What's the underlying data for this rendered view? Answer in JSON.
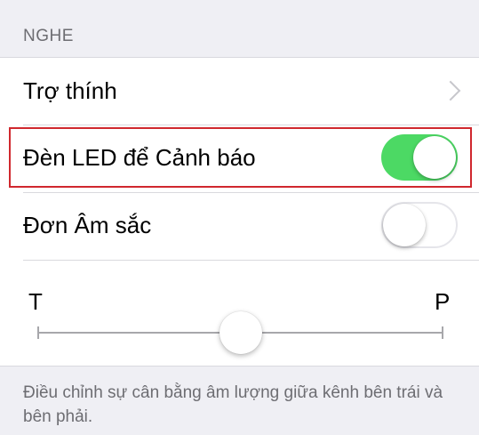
{
  "section": {
    "header": "NGHE"
  },
  "rows": {
    "hearing_aids": {
      "label": "Trợ thính"
    },
    "led_flash": {
      "label": "Đèn LED để Cảnh báo",
      "on": true
    },
    "mono_audio": {
      "label": "Đơn Âm sắc",
      "on": false
    }
  },
  "balance": {
    "left_label": "T",
    "right_label": "P",
    "value": 0.5
  },
  "footer": {
    "text": "Điều chỉnh sự cân bằng âm lượng giữa kênh bên trái và bên phải."
  },
  "colors": {
    "toggle_on": "#4cd964",
    "highlight": "#d0282e",
    "background": "#efeff4"
  },
  "icons": {
    "disclosure": "chevron-right-icon"
  }
}
